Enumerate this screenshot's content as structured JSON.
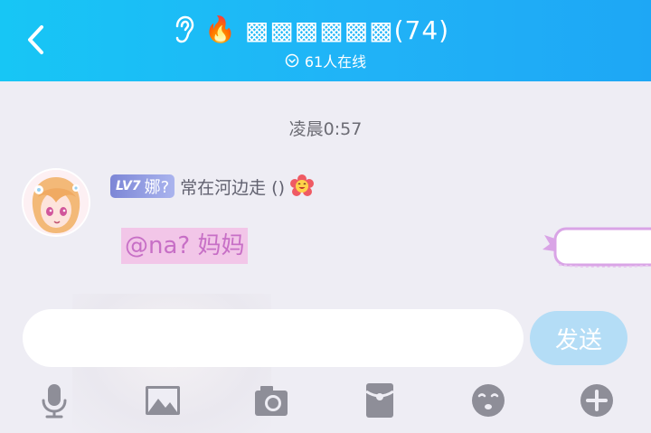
{
  "header": {
    "title": "▩▩▩▩▩▩(74)",
    "fire_emoji": "🔥",
    "online_text": "61人在线"
  },
  "chat": {
    "timestamp": "凌晨0:57",
    "message": {
      "level": "LV7",
      "level_nick": "娜?",
      "sender": "常在河边走 ()",
      "text": "@na? 妈妈"
    }
  },
  "composer": {
    "input_value": "",
    "send_label": "发送"
  },
  "toolbar": {
    "items": [
      "microphone-icon",
      "image-icon",
      "camera-icon",
      "red-packet-icon",
      "emoji-icon",
      "plus-icon"
    ]
  },
  "colors": {
    "header_start": "#17c6f5",
    "header_end": "#1ea7f5",
    "message_highlight": "#f2c6e8",
    "message_text": "#c76fc6",
    "send_button": "#b4ddf6",
    "icon_gray": "#8e8e98"
  }
}
